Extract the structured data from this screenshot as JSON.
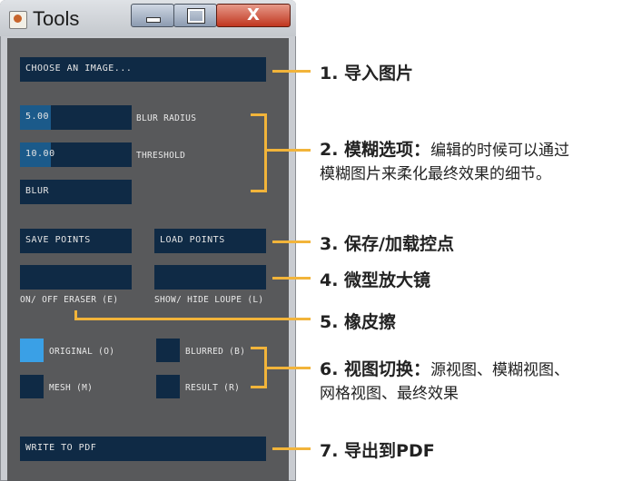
{
  "window": {
    "title": "Tools",
    "close_glyph": "X"
  },
  "panel": {
    "choose_image": "CHOOSE AN IMAGE...",
    "blur_radius_value": "5.00",
    "blur_radius_label": "BLUR RADIUS",
    "threshold_value": "10.00",
    "threshold_label": "THRESHOLD",
    "blur_button": "BLUR",
    "save_points": "SAVE POINTS",
    "load_points": "LOAD POINTS",
    "eraser_label": "ON/ OFF ERASER (E)",
    "loupe_label": "SHOW/ HIDE LOUPE (L)",
    "views": {
      "original": "ORIGINAL (O)",
      "blurred": "BLURRED (B)",
      "mesh": "MESH (M)",
      "result": "RESULT (R)"
    },
    "write_pdf": "WRITE TO PDF"
  },
  "annotations": {
    "a1": "1. 导入图片",
    "a2_title": "2. 模糊选项：",
    "a2_desc1": "编辑的时候可以通过",
    "a2_desc2": "模糊图片来柔化最终效果的细节。",
    "a3": "3. 保存/加载控点",
    "a4": "4. 微型放大镜",
    "a5": "5. 橡皮擦",
    "a6_title": "6. 视图切换：",
    "a6_desc1": "源视图、模糊视图、",
    "a6_desc2": "网格视图、最终效果",
    "a7": "7. 导出到PDF"
  },
  "accent_color": "#f2b43a",
  "active_view_color": "#3aa0e6"
}
